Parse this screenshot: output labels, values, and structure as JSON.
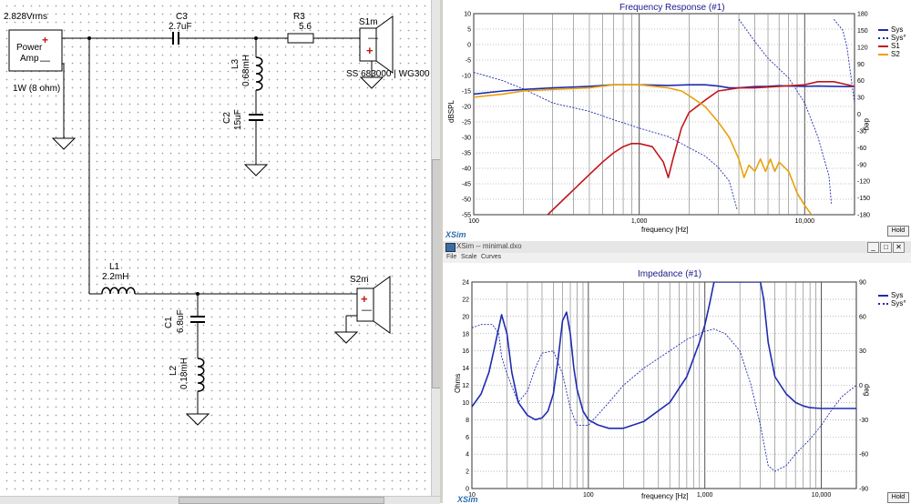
{
  "schematic": {
    "source": {
      "voltage": "2.828Vrms",
      "name_line1": "Power",
      "name_line2": "Amp",
      "plus": "+",
      "minus": "—",
      "power": "1W (8 ohm)"
    },
    "components": {
      "c3": {
        "ref": "C3",
        "value": "2.7uF"
      },
      "r3": {
        "ref": "R3",
        "value": "5.6"
      },
      "l3": {
        "ref": "L3",
        "value": "0.68mH"
      },
      "c2": {
        "ref": "C2",
        "value": "15uF"
      },
      "l1": {
        "ref": "L1",
        "value": "2.2mH"
      },
      "c1": {
        "ref": "C1",
        "value": "6.8uF"
      },
      "l2": {
        "ref": "L2",
        "value": "0.18mH"
      }
    },
    "drivers": {
      "s1m": {
        "ref": "S1m",
        "model": "SS 683000 | WG300",
        "plus": "+",
        "minus": "—"
      },
      "s2m": {
        "ref": "S2m",
        "plus": "+",
        "minus": "—"
      }
    }
  },
  "frequency_response": {
    "title": "Frequency Response (#1)",
    "xlabel": "frequency [Hz]",
    "ylabel_left": "dBSPL",
    "ylabel_right": "deg",
    "xticks": [
      "100",
      "1,000",
      "10,000"
    ],
    "yticks_left": [
      "10",
      "5",
      "0",
      "-5",
      "-10",
      "-15",
      "-20",
      "-25",
      "-30",
      "-35",
      "-40",
      "-45",
      "-50",
      "-55"
    ],
    "yticks_right": [
      "180",
      "150",
      "120",
      "90",
      "60",
      "30",
      "0",
      "-30",
      "-60",
      "-90",
      "-120",
      "-150",
      "-180"
    ],
    "legend": [
      {
        "name": "Sys",
        "color": "#1f2bb0",
        "style": "solid"
      },
      {
        "name": "Sys°",
        "color": "#1f2bb0",
        "style": "dotted"
      },
      {
        "name": "S1",
        "color": "#c0161b",
        "style": "solid"
      },
      {
        "name": "S2",
        "color": "#e8a20a",
        "style": "solid"
      }
    ],
    "brand": "XSim",
    "hold_label": "Hold"
  },
  "impedance_window": {
    "window_title": "XSim -- minimal.dxo",
    "menu": [
      "File",
      "Scale",
      "Curves"
    ],
    "buttons": [
      "_",
      "□",
      "✕"
    ]
  },
  "impedance": {
    "title": "Impedance (#1)",
    "xlabel": "frequency [Hz]",
    "ylabel_left": "Ohms",
    "ylabel_right": "deg",
    "xticks": [
      "10",
      "100",
      "1,000",
      "10,000"
    ],
    "yticks_left": [
      "24",
      "22",
      "20",
      "18",
      "16",
      "14",
      "12",
      "10",
      "8",
      "6",
      "4",
      "2",
      "0"
    ],
    "yticks_right": [
      "90",
      "60",
      "30",
      "0",
      "-30",
      "-60",
      "-90"
    ],
    "legend": [
      {
        "name": "Sys",
        "color": "#1f2bb0",
        "style": "solid"
      },
      {
        "name": "Sys°",
        "color": "#1f2bb0",
        "style": "dotted"
      }
    ],
    "brand": "XSim",
    "hold_label": "Hold"
  },
  "chart_data": [
    {
      "type": "line",
      "title": "Frequency Response (#1)",
      "xlabel": "frequency [Hz]",
      "ylabel": "dBSPL",
      "xscale": "log",
      "xlim": [
        100,
        20000
      ],
      "ylim": [
        -55,
        10
      ],
      "y2lim": [
        -180,
        180
      ],
      "legend": "top-right",
      "grid": true,
      "series": [
        {
          "name": "Sys",
          "axis": "left",
          "x": [
            100,
            150,
            200,
            300,
            500,
            700,
            1000,
            1500,
            2000,
            2500,
            3000,
            3500,
            4000,
            5000,
            6000,
            7000,
            8000,
            10000,
            12000,
            15000,
            18000,
            20000
          ],
          "y": [
            -16,
            -15,
            -14.5,
            -14,
            -13.5,
            -13,
            -13,
            -13.2,
            -13,
            -13,
            -13.4,
            -14,
            -14,
            -13.6,
            -13.5,
            -13.3,
            -13.4,
            -13.5,
            -13.4,
            -13.5,
            -13.6,
            -13.5
          ]
        },
        {
          "name": "Sys°",
          "axis": "right",
          "x": [
            100,
            150,
            200,
            300,
            500,
            700,
            1000,
            1500,
            2000,
            2500,
            3000,
            3500,
            3900,
            4000,
            5000,
            6000,
            8000,
            10000,
            12000,
            14000,
            14500,
            15000,
            17000,
            18000,
            20000
          ],
          "y": [
            75,
            60,
            45,
            20,
            5,
            -10,
            -25,
            -40,
            -60,
            -75,
            -95,
            -120,
            -170,
            170,
            130,
            100,
            65,
            20,
            -40,
            -110,
            -160,
            170,
            150,
            120,
            20
          ]
        },
        {
          "name": "S1",
          "axis": "left",
          "x": [
            280,
            350,
            400,
            500,
            600,
            700,
            800,
            900,
            1000,
            1200,
            1400,
            1500,
            1600,
            1800,
            2000,
            2500,
            3000,
            4000,
            5000,
            7000,
            10000,
            12000,
            15000,
            20000
          ],
          "y": [
            -55,
            -50,
            -47,
            -42,
            -38,
            -35,
            -33,
            -32,
            -32,
            -33,
            -38,
            -43,
            -37,
            -27,
            -22,
            -18,
            -15,
            -14,
            -14,
            -13.5,
            -13,
            -12,
            -12,
            -13.5
          ]
        },
        {
          "name": "S2",
          "axis": "left",
          "x": [
            100,
            150,
            200,
            300,
            500,
            700,
            1000,
            1500,
            1800,
            2000,
            2500,
            3000,
            3500,
            4000,
            4300,
            4600,
            5000,
            5400,
            5800,
            6200,
            6600,
            7000,
            8000,
            9000,
            10000,
            11000
          ],
          "y": [
            -17,
            -16,
            -15,
            -14.5,
            -14,
            -13,
            -13,
            -14,
            -15,
            -16.5,
            -20,
            -25,
            -30,
            -37,
            -43,
            -39,
            -41,
            -37,
            -41,
            -37,
            -41,
            -38,
            -41,
            -48,
            -52,
            -55
          ]
        }
      ]
    },
    {
      "type": "line",
      "title": "Impedance (#1)",
      "xlabel": "frequency [Hz]",
      "ylabel": "Ohms",
      "xscale": "log",
      "xlim": [
        10,
        20000
      ],
      "ylim": [
        0,
        24
      ],
      "y2lim": [
        -90,
        90
      ],
      "legend": "top-right",
      "grid": true,
      "series": [
        {
          "name": "Sys",
          "axis": "left",
          "x": [
            10,
            12,
            14,
            16,
            18,
            20,
            22,
            25,
            30,
            35,
            40,
            45,
            50,
            55,
            60,
            65,
            70,
            75,
            80,
            90,
            100,
            120,
            150,
            200,
            300,
            500,
            700,
            900,
            1000,
            1100,
            1200,
            1250,
            3000,
            3200,
            3500,
            4000,
            5000,
            6000,
            7000,
            8000,
            10000,
            12000,
            15000,
            20000
          ],
          "y": [
            9.5,
            11,
            13.5,
            17,
            20.2,
            18,
            13.5,
            10,
            8.5,
            8,
            8.2,
            9,
            11,
            15,
            19.5,
            20.5,
            18,
            14,
            11.5,
            9,
            8,
            7.4,
            7,
            7,
            7.8,
            10,
            13,
            17,
            19,
            21.5,
            24,
            24,
            24,
            22,
            17,
            13,
            11,
            10,
            9.6,
            9.4,
            9.3,
            9.3,
            9.3,
            9.3
          ]
        },
        {
          "name": "Sys°",
          "axis": "right",
          "x": [
            10,
            12,
            15,
            17,
            18,
            20,
            25,
            30,
            35,
            40,
            50,
            60,
            70,
            80,
            100,
            150,
            200,
            300,
            500,
            700,
            1000,
            1200,
            1500,
            2000,
            2500,
            3000,
            3500,
            4000,
            5000,
            6000,
            7000,
            8000,
            10000,
            12000,
            15000,
            20000
          ],
          "y": [
            50,
            53,
            53,
            45,
            25,
            10,
            -15,
            -5,
            15,
            28,
            30,
            10,
            -20,
            -35,
            -35,
            -15,
            0,
            15,
            30,
            40,
            47,
            49,
            45,
            30,
            0,
            -35,
            -70,
            -75,
            -70,
            -60,
            -53,
            -47,
            -35,
            -23,
            -10,
            0
          ]
        }
      ]
    }
  ]
}
